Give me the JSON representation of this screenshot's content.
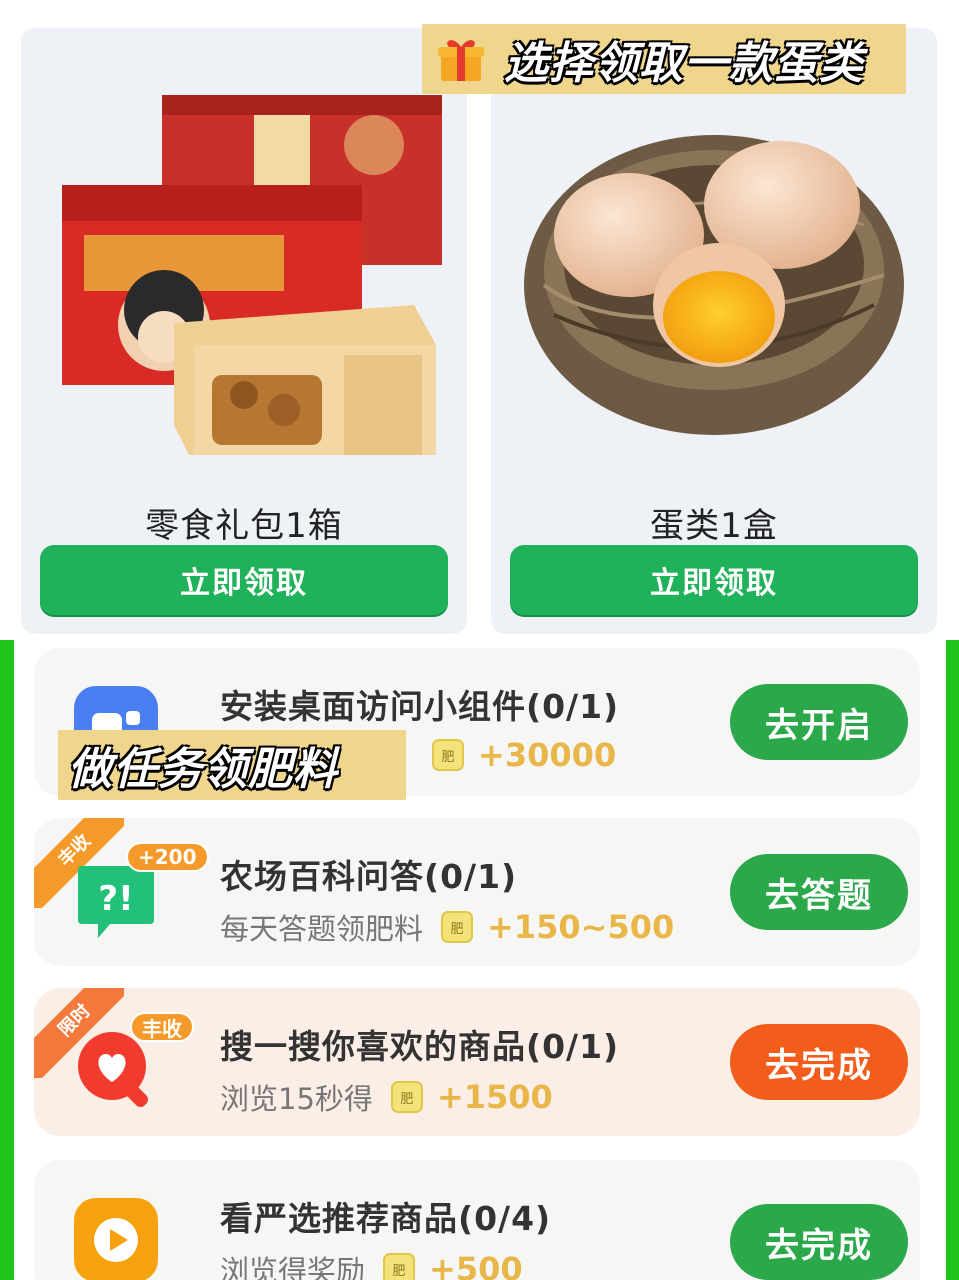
{
  "top_banner": {
    "text": "选择领取一款蛋类",
    "icon": "gift-icon"
  },
  "rewards": [
    {
      "title": "零食礼包1箱",
      "button": "立即领取",
      "image": "snack-gift-box-image"
    },
    {
      "title": "蛋类1盒",
      "button": "立即领取",
      "image": "eggs-in-nest-image"
    }
  ],
  "overlay_banner": {
    "text": "做任务领肥料"
  },
  "fertilizer_icon_label": "肥",
  "tasks": [
    {
      "title": "安装桌面访问小组件(0/1)",
      "subtitle": "",
      "reward": "+30000",
      "button": "去开启",
      "icon": "widget-icon",
      "tag": ""
    },
    {
      "title": "农场百科问答(0/1)",
      "subtitle": "每天答题领肥料",
      "reward": "+150~500",
      "button": "去答题",
      "icon": "quiz-icon",
      "tag": "丰收",
      "badge": "+200"
    },
    {
      "title": "搜一搜你喜欢的商品(0/1)",
      "subtitle": "浏览15秒得",
      "reward": "+1500",
      "button": "去完成",
      "icon": "heart-search-icon",
      "tag": "限时",
      "badge": "丰收"
    },
    {
      "title": "看严选推荐商品(0/4)",
      "subtitle": "浏览得奖励",
      "reward": "+500",
      "button": "去完成",
      "icon": "play-icon",
      "tag": ""
    }
  ],
  "colors": {
    "primary_green": "#20b25a",
    "task_green": "#2aa84a",
    "orange": "#f35d1b",
    "border_green": "#1fc41a",
    "banner_yellow": "#f0d58c"
  }
}
